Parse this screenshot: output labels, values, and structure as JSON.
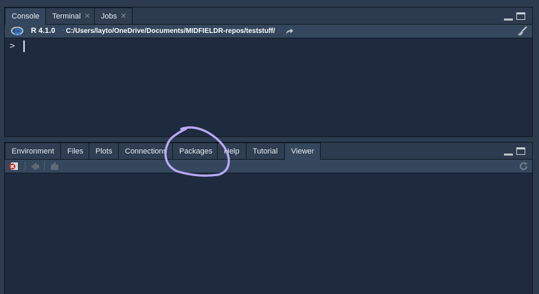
{
  "console_pane": {
    "tabs": [
      {
        "label": "Console",
        "closable": false,
        "active": true
      },
      {
        "label": "Terminal",
        "closable": true,
        "active": false
      },
      {
        "label": "Jobs",
        "closable": true,
        "active": false
      }
    ],
    "r_version": "R 4.1.0",
    "separator": "·",
    "working_dir": "C:/Users/layto/OneDrive/Documents/MIDFIELDR-repos/teststuff/",
    "prompt": ">"
  },
  "bottom_pane": {
    "tabs": [
      {
        "label": "Environment",
        "active": false
      },
      {
        "label": "Files",
        "active": false
      },
      {
        "label": "Plots",
        "active": false
      },
      {
        "label": "Connections",
        "active": false
      },
      {
        "label": "Packages",
        "active": false
      },
      {
        "label": "Help",
        "active": false
      },
      {
        "label": "Tutorial",
        "active": false
      },
      {
        "label": "Viewer",
        "active": true
      }
    ]
  },
  "icons": {
    "r_logo": "r-logo-icon",
    "goto_dir": "arrow-right-curved-icon",
    "clear_console": "broom-icon",
    "minimize": "minimize-pane-icon",
    "maximize": "maximize-pane-icon",
    "viewer_clear": "clear-viewer-icon",
    "viewer_back": "back-arrow-icon",
    "viewer_export": "export-icon",
    "viewer_refresh": "refresh-icon"
  },
  "colors": {
    "pane_background": "#1e2a3e",
    "chrome_background": "#2c3b4d",
    "annotation": "#b7a9f3"
  }
}
